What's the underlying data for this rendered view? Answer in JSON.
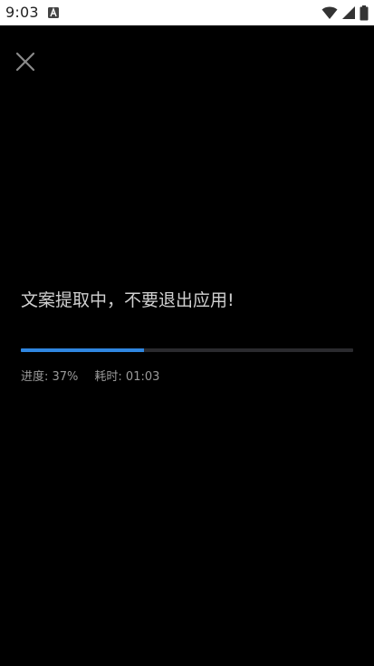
{
  "status_bar": {
    "time": "9:03",
    "notification_icon": "a-icon",
    "wifi_icon": "wifi-icon",
    "signal_icon": "cellular-signal-icon",
    "battery_icon": "battery-icon"
  },
  "screen": {
    "close_icon": "close-icon",
    "headline": "文案提取中，不要退出应用!",
    "progress_percent": 37,
    "progress_text": "进度: 37%",
    "elapsed_text": "耗时: 01:03",
    "colors": {
      "background": "#000000",
      "progress_fill": "#2f86e0",
      "progress_track": "#2a2a2e"
    }
  }
}
